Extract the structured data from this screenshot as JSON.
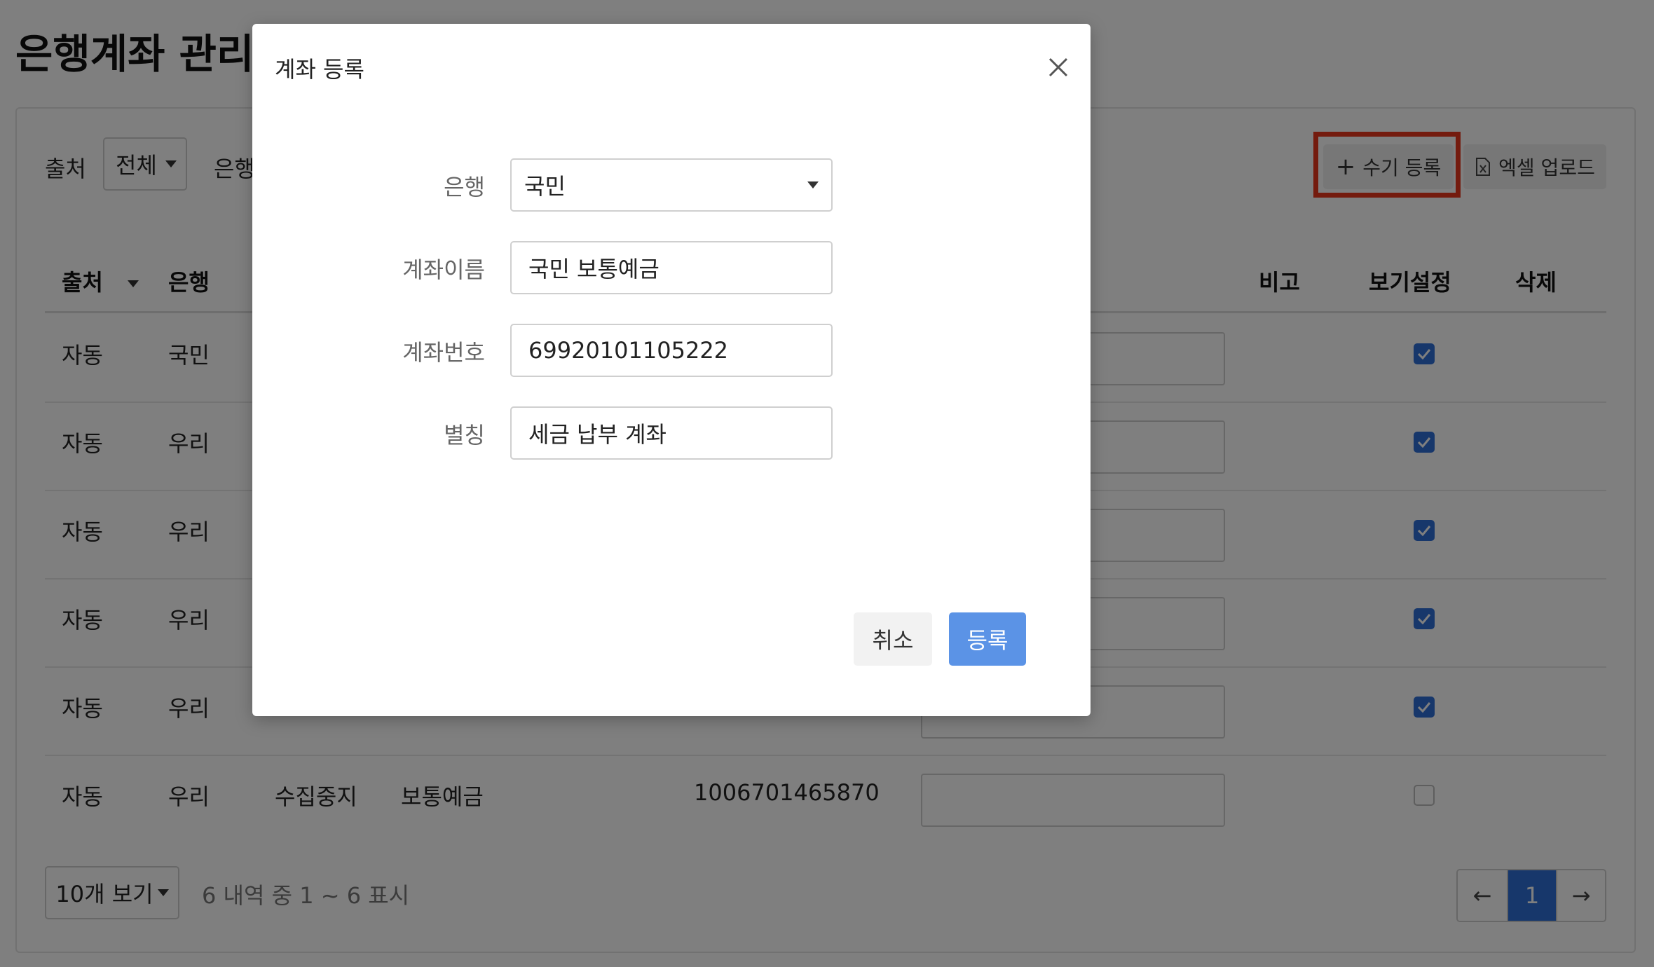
{
  "page": {
    "title": "은행계좌 관리"
  },
  "filters": {
    "source_label": "출처",
    "source_value": "전체",
    "bank_label": "은행"
  },
  "toolbar": {
    "manual_register": "수기 등록",
    "excel_upload": "엑셀 업로드"
  },
  "table": {
    "headers": {
      "source": "출처",
      "bank": "은행",
      "note": "비고",
      "visibility": "보기설정",
      "delete": "삭제"
    },
    "rows": [
      {
        "source": "자동",
        "bank": "국민",
        "status": "",
        "type": "",
        "account": "",
        "visible": true
      },
      {
        "source": "자동",
        "bank": "우리",
        "status": "",
        "type": "",
        "account": "",
        "visible": true
      },
      {
        "source": "자동",
        "bank": "우리",
        "status": "",
        "type": "",
        "account": "",
        "visible": true
      },
      {
        "source": "자동",
        "bank": "우리",
        "status": "",
        "type": "",
        "account": "",
        "visible": true
      },
      {
        "source": "자동",
        "bank": "우리",
        "status": "",
        "type": "",
        "account": "",
        "visible": true
      },
      {
        "source": "자동",
        "bank": "우리",
        "status": "수집중지",
        "type": "보통예금",
        "account": "1006701465870",
        "visible": false
      }
    ]
  },
  "pagination": {
    "per_page": "10개 보기",
    "info": "6 내역 중 1 ~ 6 표시",
    "prev": "←",
    "current": "1",
    "next": "→"
  },
  "modal": {
    "title": "계좌 등록",
    "fields": {
      "bank_label": "은행",
      "bank_value": "국민",
      "account_name_label": "계좌이름",
      "account_name_value": "국민 보통예금",
      "account_number_label": "계좌번호",
      "account_number_value": "69920101105222",
      "alias_label": "별칭",
      "alias_value": "세금 납부 계좌"
    },
    "cancel": "취소",
    "submit": "등록"
  },
  "colors": {
    "accent": "#2f6fd6",
    "submit": "#5b93e6",
    "highlight": "#e8371c"
  }
}
